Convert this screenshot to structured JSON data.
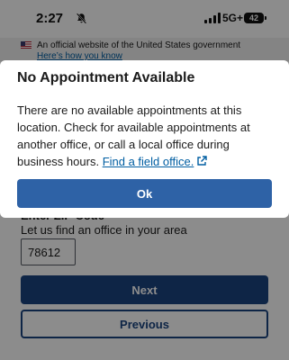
{
  "status_bar": {
    "time": "2:27",
    "network": "5G+",
    "battery": "42",
    "icons": [
      "silent-bell-icon",
      "signal-icon",
      "battery-icon"
    ]
  },
  "gov_banner": {
    "text": "An official website of the United States government",
    "link": "Here’s how you know"
  },
  "form": {
    "zip_heading": "Enter ZIP Code",
    "zip_help": "Let us find an office in your area",
    "zip_value": "78612",
    "next_label": "Next",
    "previous_label": "Previous"
  },
  "modal": {
    "title": "No Appointment Available",
    "body": "There are no available appointments at this location. Check for available appointments at another office, or call a local office during business hours.",
    "link_text": "Find a field office.",
    "ok_label": "Ok"
  },
  "colors": {
    "primary": "#1a4480",
    "ok_button": "#2e62a6",
    "link": "#005ea2"
  }
}
